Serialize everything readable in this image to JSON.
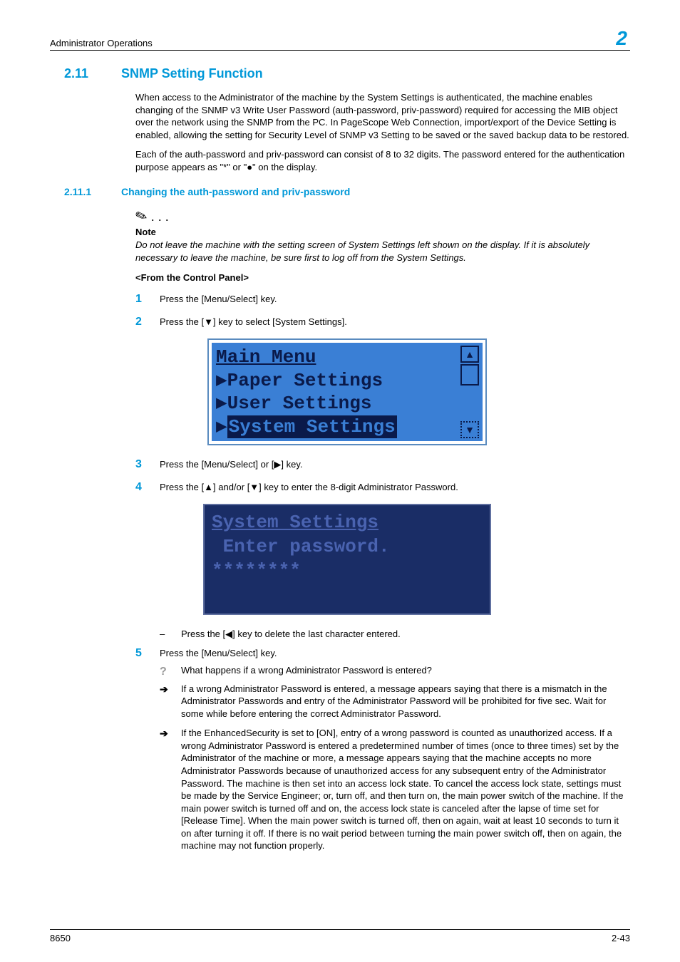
{
  "header": {
    "section": "Administrator Operations",
    "chapter_number": "2"
  },
  "h2": {
    "num": "2.11",
    "title": "SNMP Setting Function"
  },
  "intro": {
    "p1": "When access to the Administrator of the machine by the System Settings is authenticated, the machine enables changing of the SNMP v3 Write User Password (auth-password, priv-password) required for accessing the MIB object over the network using the SNMP from the PC. In PageScope Web Connection, import/export of the Device Setting is enabled, allowing the setting for Security Level of SNMP v3 Setting to be saved or the saved backup data to be restored.",
    "p2": "Each of the auth-password and priv-password can consist of 8 to 32 digits. The password entered for the authentication purpose appears as \"*\" or \"●\" on the display."
  },
  "h3": {
    "num": "2.11.1",
    "title": "Changing the auth-password and priv-password"
  },
  "note": {
    "label": "Note",
    "text": "Do not leave the machine with the setting screen of System Settings left shown on the display. If it is absolutely necessary to leave the machine, be sure first to log off from the System Settings."
  },
  "subhead": "<From the Control Panel>",
  "steps": {
    "s1": "Press the [Menu/Select] key.",
    "s2": "Press the [▼] key to select [System Settings].",
    "s3": "Press the [Menu/Select] or [▶] key.",
    "s4": "Press the [▲] and/or [▼] key to enter the 8-digit Administrator Password.",
    "s4_sub": "Press the [◀] key to delete the last character entered.",
    "s5": "Press the [Menu/Select] key.",
    "s5_q": "What happens if a wrong Administrator Password is entered?",
    "s5_a1": "If a wrong Administrator Password is entered, a message appears saying that there is a mismatch in the Administrator Passwords and entry of the Administrator Password will be prohibited for five sec. Wait for some while before entering the correct Administrator Password.",
    "s5_a2": "If the EnhancedSecurity is set to [ON], entry of a wrong password is counted as unauthorized access. If a wrong Administrator Password is entered a predetermined number of times (once to three times) set by the Administrator of the machine or more, a message appears saying that the machine accepts no more Administrator Passwords because of unauthorized access for any subsequent entry of the Administrator Password. The machine is then set into an access lock state. To cancel the access lock state, settings must be made by the Service Engineer; or, turn off, and then turn on, the main power switch of the machine. If the main power switch is turned off and on, the access lock state is canceled after the lapse of time set for [Release Time]. When the main power switch is turned off, then on again, wait at least 10 seconds to turn it on after turning it off. If there is no wait period between turning the main power switch off, then on again, the machine may not function properly."
  },
  "lcd1": {
    "title": "Main Menu",
    "line1": "▶Paper Settings",
    "line2": "▶User Settings",
    "line3_prefix": "▶",
    "line3_text": "System Settings"
  },
  "lcd2": {
    "title": "System Settings",
    "line1": " Enter password.",
    "line2": "********"
  },
  "footer": {
    "left": "8650",
    "right": "2-43"
  },
  "markers": {
    "dash": "–",
    "arrow": "➔",
    "question": "?"
  }
}
